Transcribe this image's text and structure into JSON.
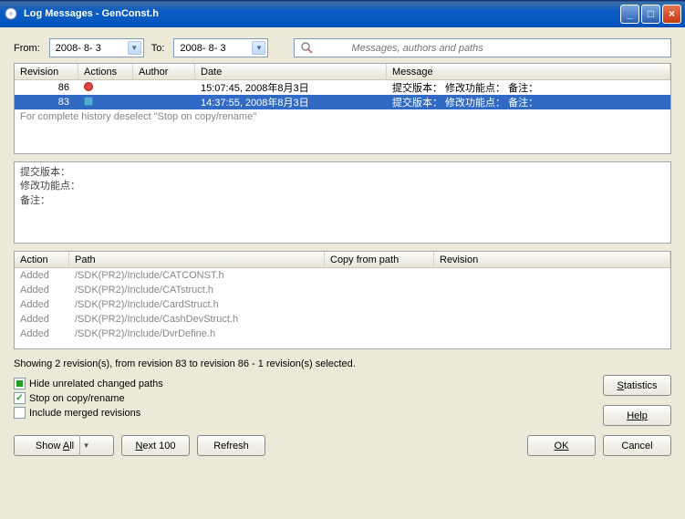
{
  "window": {
    "title": "Log Messages - GenConst.h"
  },
  "filter": {
    "from_label": "From:",
    "to_label": "To:",
    "from": "2008- 8- 3",
    "to": "2008- 8- 3",
    "search_placeholder": "Messages, authors and paths"
  },
  "revisions": {
    "headers": {
      "revision": "Revision",
      "actions": "Actions",
      "author": "Author",
      "date": "Date",
      "message": "Message"
    },
    "rows": [
      {
        "rev": "86",
        "author": "",
        "date": "15:07:45, 2008年8月3日",
        "message": "提交版本： 修改功能点： 备注：",
        "selected": false,
        "icon": "red"
      },
      {
        "rev": "83",
        "author": "",
        "date": "14:37:55, 2008年8月3日",
        "message": "提交版本： 修改功能点： 备注：",
        "selected": true,
        "icon": "blue"
      }
    ],
    "hint": "For complete history deselect \"Stop on copy/rename\""
  },
  "detail": {
    "l1": "提交版本：",
    "l2": "修改功能点：",
    "l3": "备注："
  },
  "paths": {
    "headers": {
      "action": "Action",
      "path": "Path",
      "copy": "Copy from path",
      "rev": "Revision"
    },
    "rows": [
      {
        "action": "Added",
        "path": "/SDK(PR2)/Include/CATCONST.h"
      },
      {
        "action": "Added",
        "path": "/SDK(PR2)/Include/CATstruct.h"
      },
      {
        "action": "Added",
        "path": "/SDK(PR2)/Include/CardStruct.h"
      },
      {
        "action": "Added",
        "path": "/SDK(PR2)/Include/CashDevStruct.h"
      },
      {
        "action": "Added",
        "path": "/SDK(PR2)/Include/DvrDefine.h"
      }
    ]
  },
  "status": "Showing 2 revision(s), from revision 83 to revision 86 - 1 revision(s) selected.",
  "checks": {
    "hide": "Hide unrelated changed paths",
    "stop": "Stop on copy/rename",
    "merged": "Include merged revisions"
  },
  "buttons": {
    "stats": "Statistics",
    "help": "Help",
    "showall": "Show All",
    "next": "Next 100",
    "refresh": "Refresh",
    "ok": "OK",
    "cancel": "Cancel"
  }
}
